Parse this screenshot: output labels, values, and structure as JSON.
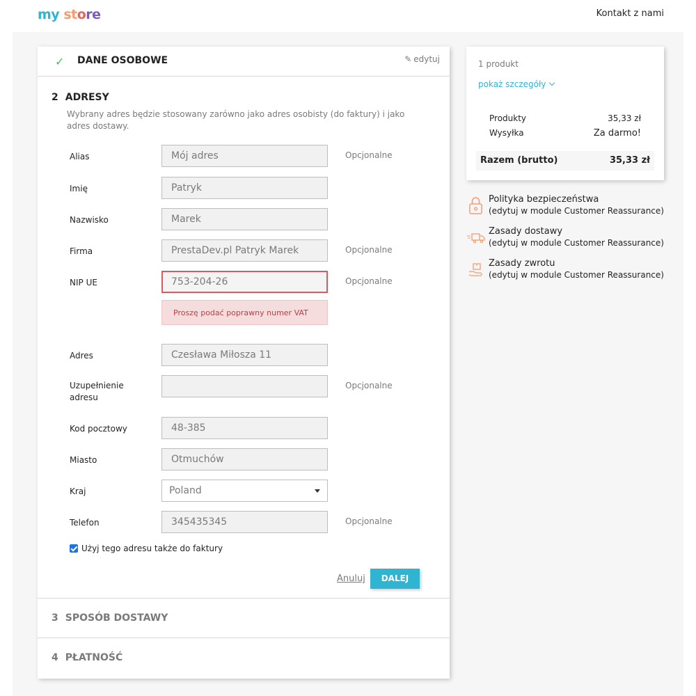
{
  "header": {
    "logo_parts": [
      "my",
      "st",
      "o",
      "re"
    ],
    "contact_label": "Kontakt z nami"
  },
  "step1": {
    "title": "DANE OSOBOWE",
    "edit_label": "edytuj"
  },
  "step2": {
    "number": "2",
    "title": "ADRESY",
    "description": "Wybrany adres będzie stosowany zarówno jako adres osobisty (do faktury) i jako adres dostawy.",
    "optional_label": "Opcjonalne",
    "fields": {
      "alias": {
        "label": "Alias",
        "value": "Mój adres"
      },
      "firstname": {
        "label": "Imię",
        "value": "Patryk"
      },
      "lastname": {
        "label": "Nazwisko",
        "value": "Marek"
      },
      "company": {
        "label": "Firma",
        "value": "PrestaDev.pl Patryk Marek"
      },
      "vat": {
        "label": "NIP UE",
        "value": "753-204-26",
        "error": "Proszę podać poprawny numer VAT"
      },
      "address1": {
        "label": "Adres",
        "value": "Czesława Miłosza 11"
      },
      "address2": {
        "label": "Uzupełnienie adresu",
        "value": ""
      },
      "postcode": {
        "label": "Kod pocztowy",
        "value": "48-385"
      },
      "city": {
        "label": "Miasto",
        "value": "Otmuchów"
      },
      "country": {
        "label": "Kraj",
        "value": "Poland"
      },
      "phone": {
        "label": "Telefon",
        "value": "345435345"
      }
    },
    "invoice_checkbox_label": "Użyj tego adresu także do faktury",
    "cancel_label": "Anuluj",
    "next_label": "DALEJ"
  },
  "step3": {
    "number": "3",
    "title": "SPOSÓB DOSTAWY"
  },
  "step4": {
    "number": "4",
    "title": "PŁATNOŚĆ"
  },
  "summary": {
    "count": "1 produkt",
    "details_label": "pokaż szczegóły",
    "products_label": "Produkty",
    "products_value": "35,33 zł",
    "shipping_label": "Wysyłka",
    "shipping_value": "Za darmo!",
    "total_label": "Razem (brutto)",
    "total_value": "35,33 zł"
  },
  "reassurance": [
    {
      "title": "Polityka bezpieczeństwa",
      "subtitle": "(edytuj w module Customer Reassurance)"
    },
    {
      "title": "Zasady dostawy",
      "subtitle": "(edytuj w module Customer Reassurance)"
    },
    {
      "title": "Zasady zwrotu",
      "subtitle": "(edytuj w module Customer Reassurance)"
    }
  ],
  "colors": {
    "accent": "#2fb5d2",
    "error": "#db5a62",
    "check": "#4cbb6c",
    "icon_orange": "#f39d72"
  }
}
